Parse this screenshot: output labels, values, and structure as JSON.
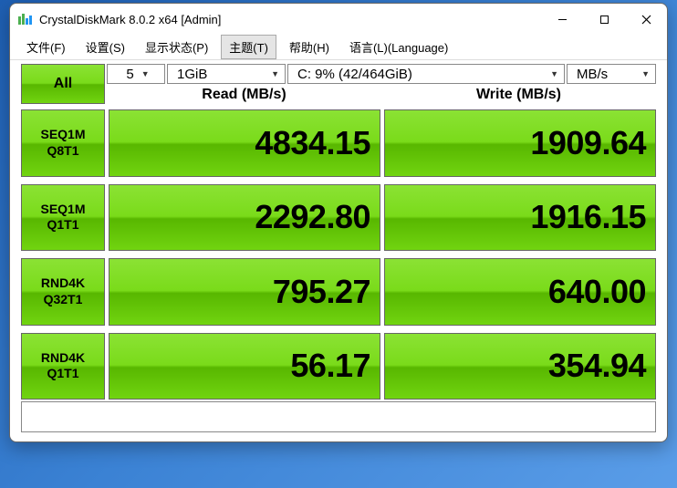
{
  "window": {
    "title": "CrystalDiskMark 8.0.2 x64 [Admin]"
  },
  "menu": {
    "file": "文件(F)",
    "settings": "设置(S)",
    "status": "显示状态(P)",
    "theme": "主题(T)",
    "help": "帮助(H)",
    "language": "语言(L)(Language)"
  },
  "controls": {
    "all_label": "All",
    "test_count": "5",
    "test_size": "1GiB",
    "drive": "C: 9% (42/464GiB)",
    "unit": "MB/s"
  },
  "headers": {
    "read": "Read (MB/s)",
    "write": "Write (MB/s)"
  },
  "tests": [
    {
      "line1": "SEQ1M",
      "line2": "Q8T1",
      "read": "4834.15",
      "write": "1909.64"
    },
    {
      "line1": "SEQ1M",
      "line2": "Q1T1",
      "read": "2292.80",
      "write": "1916.15"
    },
    {
      "line1": "RND4K",
      "line2": "Q32T1",
      "read": "795.27",
      "write": "640.00"
    },
    {
      "line1": "RND4K",
      "line2": "Q1T1",
      "read": "56.17",
      "write": "354.94"
    }
  ],
  "chart_data": {
    "type": "table",
    "title": "CrystalDiskMark 8.0.2 x64 Benchmark Results",
    "unit": "MB/s",
    "drive": "C: 9% (42/464GiB)",
    "test_size": "1GiB",
    "test_count": 5,
    "columns": [
      "Test",
      "Read (MB/s)",
      "Write (MB/s)"
    ],
    "rows": [
      [
        "SEQ1M Q8T1",
        4834.15,
        1909.64
      ],
      [
        "SEQ1M Q1T1",
        2292.8,
        1916.15
      ],
      [
        "RND4K Q32T1",
        795.27,
        640.0
      ],
      [
        "RND4K Q1T1",
        56.17,
        354.94
      ]
    ]
  }
}
